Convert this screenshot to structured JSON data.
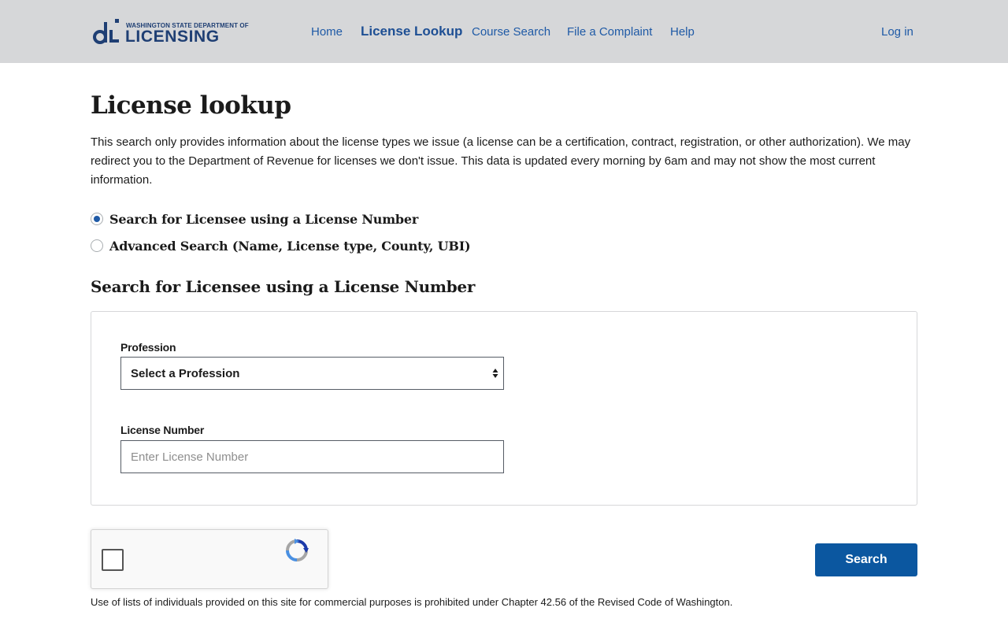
{
  "header": {
    "logo": {
      "small_text": "WASHINGTON STATE DEPARTMENT OF",
      "big_text": "LICENSING",
      "icon": "dol-logo-icon"
    },
    "nav": {
      "home": "Home",
      "license_lookup": "License Lookup",
      "course_search": "Course Search",
      "file_complaint": "File a Complaint",
      "help": "Help",
      "login": "Log in"
    }
  },
  "main": {
    "title": "License lookup",
    "intro": "This search only provides information about the license types we issue (a license can be a certification, contract, registration, or other authorization). We may redirect you to the Department of Revenue for licenses we don't issue. This data is updated every morning by 6am and may not show the most current information.",
    "search_options": [
      {
        "label": "Search for Licensee using a License Number",
        "selected": true
      },
      {
        "label": "Advanced Search (Name, License type, County, UBI)",
        "selected": false
      }
    ],
    "section_title": "Search for Licensee using a License Number",
    "form": {
      "profession_label": "Profession",
      "profession_value": "Select a Profession",
      "license_number_label": "License Number",
      "license_number_placeholder": "Enter License Number",
      "license_number_value": ""
    },
    "captcha": {
      "icon": "recaptcha-icon",
      "checked": false
    },
    "search_button": "Search",
    "footnote": "Use of lists of individuals provided on this site for commercial purposes is prohibited under Chapter 42.56 of the Revised Code of Washington."
  },
  "colors": {
    "header_bg": "#d6d7d9",
    "nav_link": "#1f5aa6",
    "logo": "#1f3f74",
    "primary_button": "#0b57a0",
    "radio_selected": "#1f5aa6"
  }
}
